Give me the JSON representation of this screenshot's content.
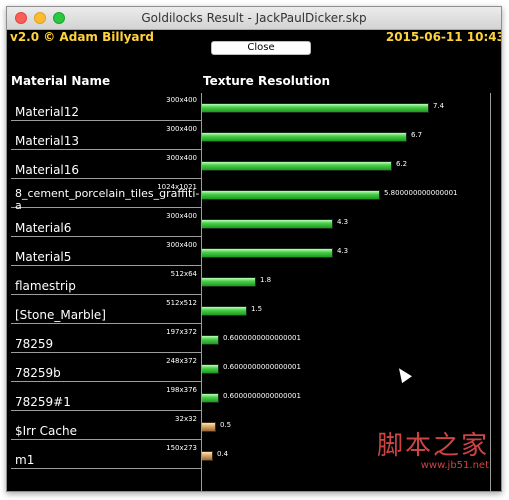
{
  "window": {
    "title": "Goldilocks Result - JackPaulDicker.skp"
  },
  "header": {
    "version": "v2.0 © Adam Billyard",
    "date": "2015-06-11 10:43",
    "close_label": "Close"
  },
  "table": {
    "col_material": "Material Name",
    "col_texture": "Texture Resolution",
    "rows": [
      {
        "name": "Material12",
        "resolution": "300x400",
        "value": 7.4,
        "value_label": "7.4",
        "color": "green"
      },
      {
        "name": "Material13",
        "resolution": "300x400",
        "value": 6.7,
        "value_label": "6.7",
        "color": "green"
      },
      {
        "name": "Material16",
        "resolution": "300x400",
        "value": 6.2,
        "value_label": "6.2",
        "color": "green"
      },
      {
        "name": "8_cement_porcelain_tiles_graffiti-a",
        "resolution": "1024x1021",
        "value": 5.8,
        "value_label": "5.800000000000001",
        "color": "green"
      },
      {
        "name": "Material6",
        "resolution": "300x400",
        "value": 4.3,
        "value_label": "4.3",
        "color": "green"
      },
      {
        "name": "Material5",
        "resolution": "300x400",
        "value": 4.3,
        "value_label": "4.3",
        "color": "green"
      },
      {
        "name": "flamestrip",
        "resolution": "512x64",
        "value": 1.8,
        "value_label": "1.8",
        "color": "green"
      },
      {
        "name": "[Stone_Marble]",
        "resolution": "512x512",
        "value": 1.5,
        "value_label": "1.5",
        "color": "green"
      },
      {
        "name": "78259",
        "resolution": "197x372",
        "value": 0.6,
        "value_label": "0.6000000000000001",
        "color": "green"
      },
      {
        "name": "78259b",
        "resolution": "248x372",
        "value": 0.6,
        "value_label": "0.6000000000000001",
        "color": "green"
      },
      {
        "name": "78259#1",
        "resolution": "198x376",
        "value": 0.6,
        "value_label": "0.6000000000000001",
        "color": "green"
      },
      {
        "name": "$Irr Cache",
        "resolution": "32x32",
        "value": 0.5,
        "value_label": "0.5",
        "color": "tan"
      },
      {
        "name": "m1",
        "resolution": "150x273",
        "value": 0.4,
        "value_label": "0.4",
        "color": "tan"
      }
    ]
  },
  "watermark": {
    "chinese": "脚本之家",
    "url": "www.jb51.net"
  }
}
